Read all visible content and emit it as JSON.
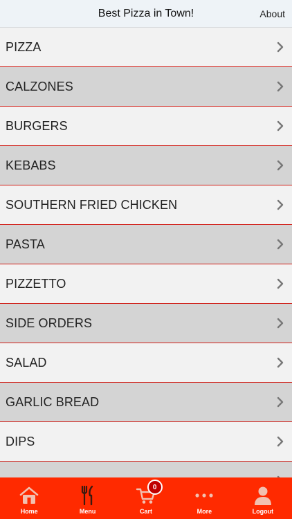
{
  "header": {
    "title": "Best Pizza in Town!",
    "about_label": "About"
  },
  "menu_items": [
    {
      "label": "PIZZA"
    },
    {
      "label": "CALZONES"
    },
    {
      "label": "BURGERS"
    },
    {
      "label": "KEBABS"
    },
    {
      "label": "SOUTHERN FRIED CHICKEN"
    },
    {
      "label": "PASTA"
    },
    {
      "label": "PIZZETTO"
    },
    {
      "label": "SIDE ORDERS"
    },
    {
      "label": "SALAD"
    },
    {
      "label": "GARLIC BREAD"
    },
    {
      "label": "DIPS"
    },
    {
      "label": ""
    }
  ],
  "tabbar": {
    "home_label": "Home",
    "menu_label": "Menu",
    "cart_label": "Cart",
    "cart_count": "0",
    "more_label": "More",
    "logout_label": "Logout"
  },
  "colors": {
    "accent": "#ff2a00",
    "divider": "#d01a14",
    "row_light": "#f2f2f2",
    "row_dark": "#d4d4d4"
  },
  "icons": [
    "chevron-right-icon",
    "home-icon",
    "fork-knife-icon",
    "cart-icon",
    "more-dots-icon",
    "user-icon"
  ]
}
